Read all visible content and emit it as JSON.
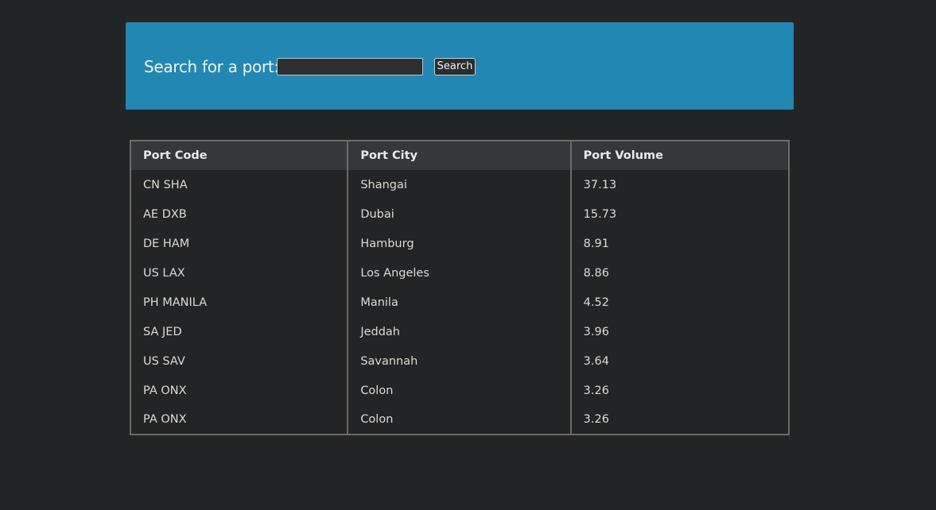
{
  "search": {
    "label": "Search for a port:",
    "input_value": "",
    "input_placeholder": "",
    "button_label": "Search"
  },
  "table": {
    "headers": {
      "code": "Port Code",
      "city": "Port City",
      "volume": "Port Volume"
    },
    "rows": [
      {
        "code": "CN SHA",
        "city": "Shangai",
        "volume": "37.13"
      },
      {
        "code": "AE DXB",
        "city": "Dubai",
        "volume": "15.73"
      },
      {
        "code": "DE HAM",
        "city": "Hamburg",
        "volume": "8.91"
      },
      {
        "code": "US LAX",
        "city": "Los Angeles",
        "volume": "8.86"
      },
      {
        "code": "PH MANILA",
        "city": "Manila",
        "volume": "4.52"
      },
      {
        "code": "SA JED",
        "city": "Jeddah",
        "volume": "3.96"
      },
      {
        "code": "US SAV",
        "city": "Savannah",
        "volume": "3.64"
      },
      {
        "code": "PA ONX",
        "city": "Colon",
        "volume": "3.26"
      },
      {
        "code": "PA ONX",
        "city": "Colon",
        "volume": "3.26"
      }
    ]
  },
  "colors": {
    "page_background": "#232425",
    "search_panel": "#2288b3",
    "table_header": "#35383b",
    "table_border": "#6f6a61"
  }
}
